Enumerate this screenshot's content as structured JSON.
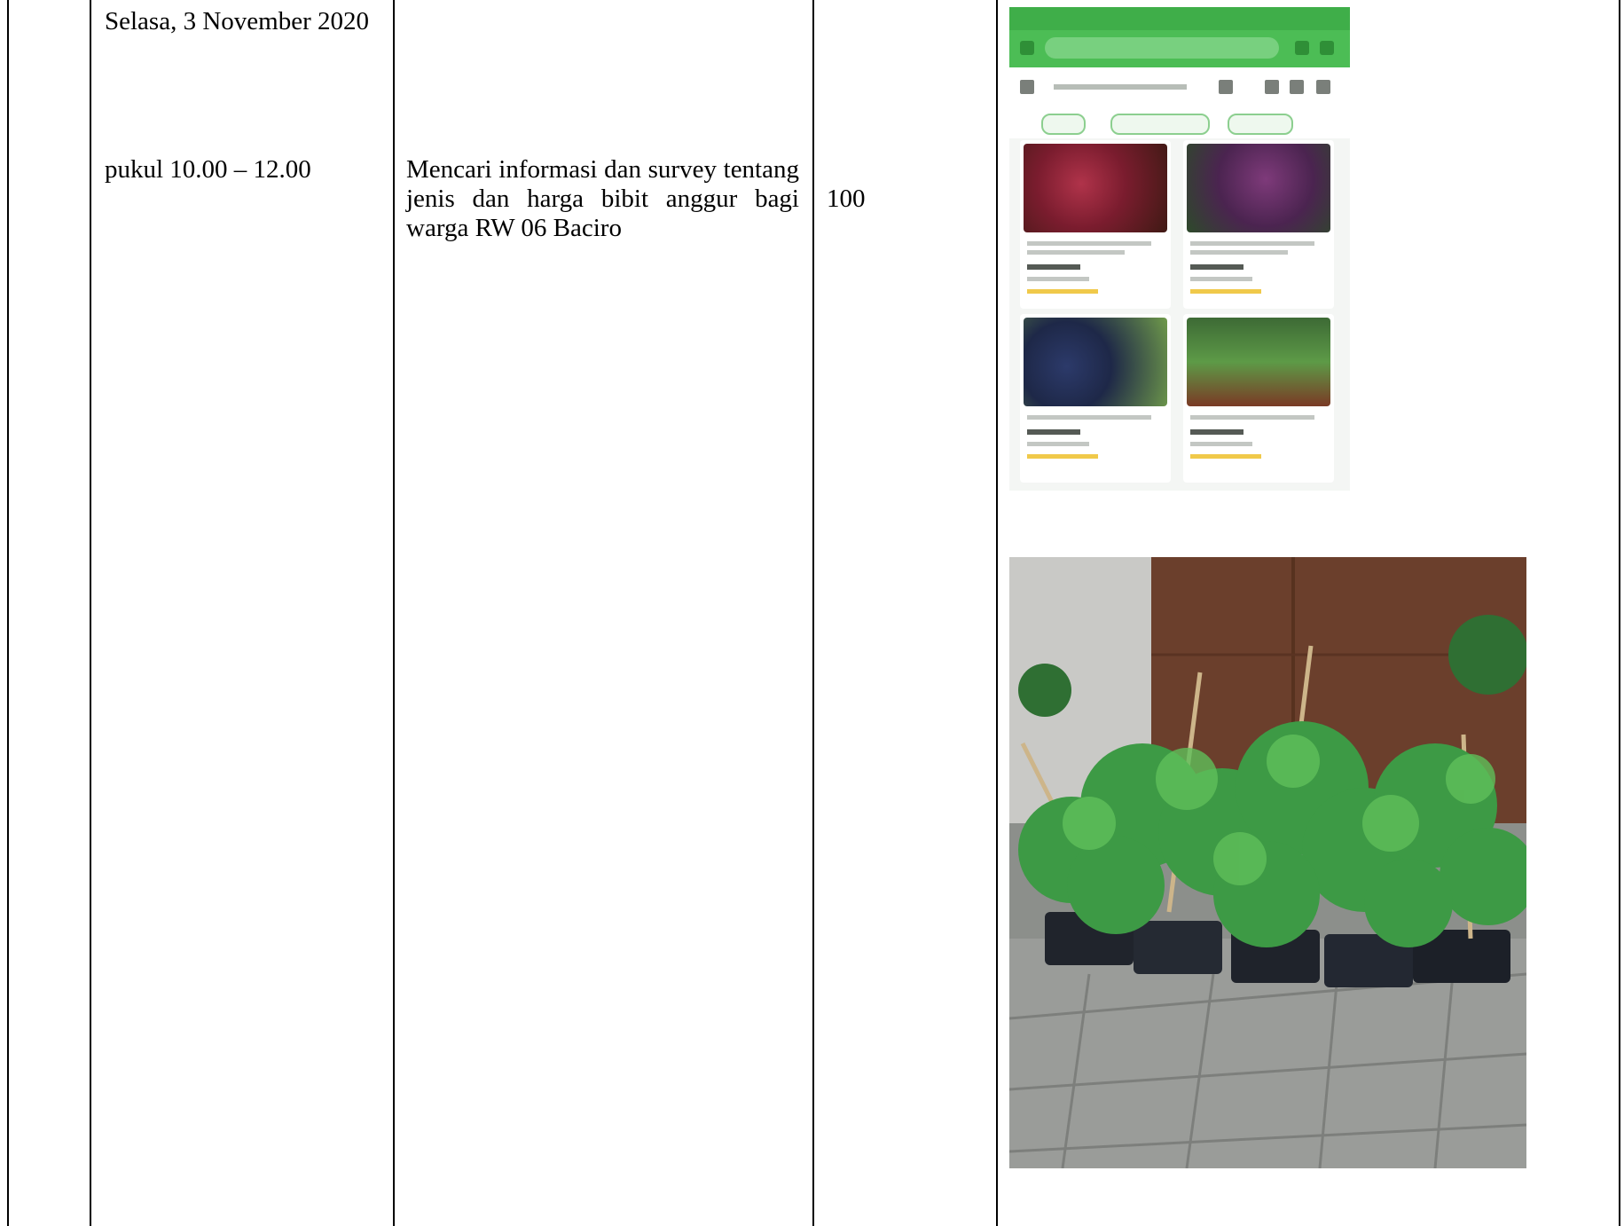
{
  "row": {
    "date": "Selasa, 3 November 2020",
    "time": "pukul 10.00 – 12.00",
    "activity": "Mencari informasi dan survey tentang jenis dan harga bibit anggur bagi warga RW 06 Baciro",
    "value": "100"
  },
  "documentation": {
    "image_1": "screenshot-marketplace-grape-seedlings",
    "image_2": "photo-grape-seedlings-in-pots"
  },
  "colors": {
    "marketplace_green": "#43b54c",
    "table_border": "#000000"
  }
}
